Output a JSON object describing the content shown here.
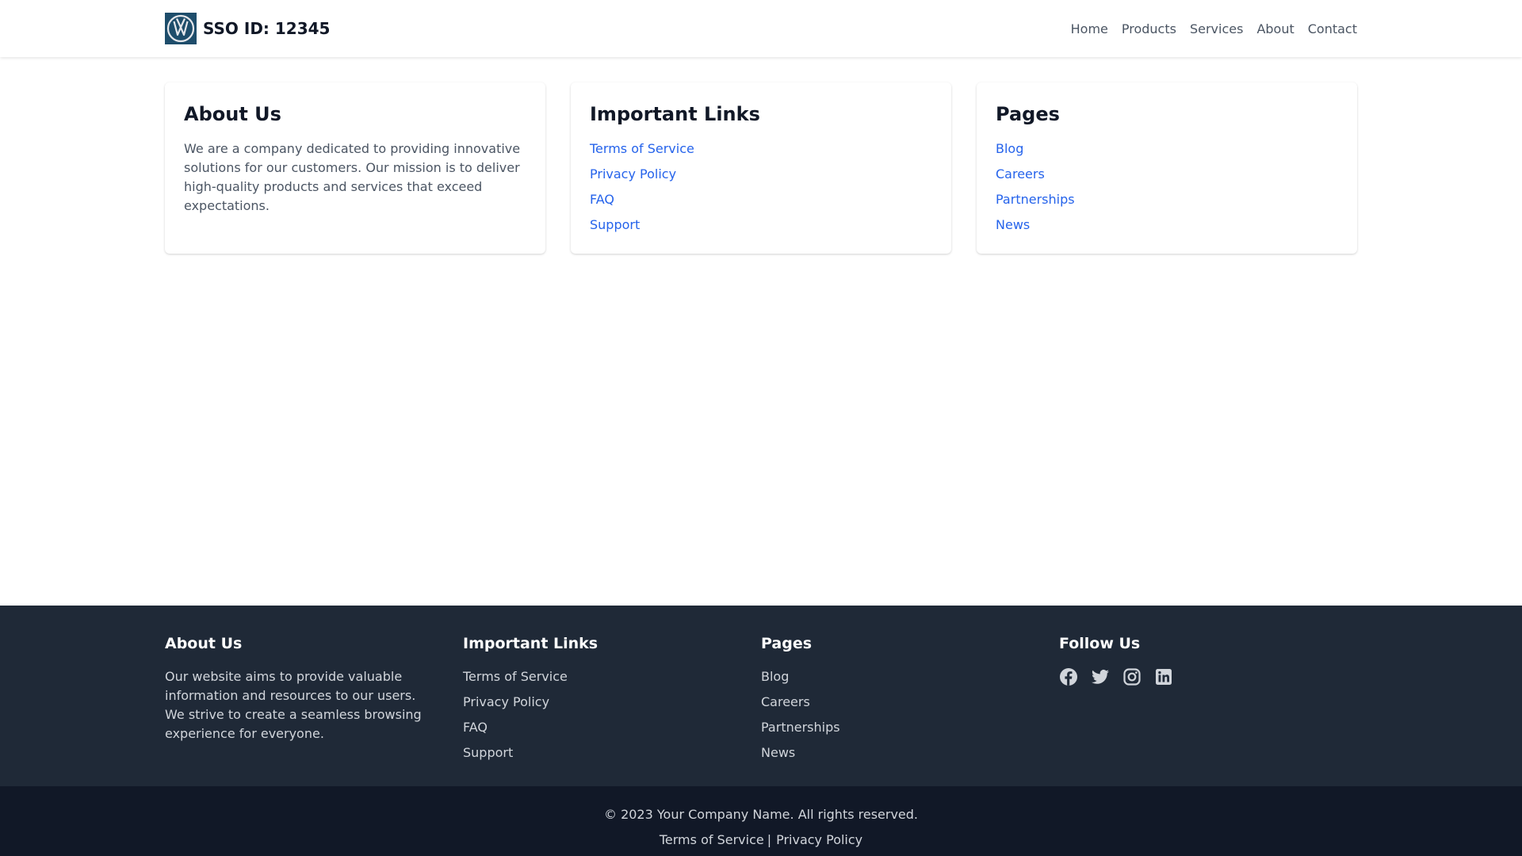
{
  "header": {
    "logo_icon": "vw-logo-icon",
    "title": "SSO ID: 12345",
    "nav": [
      {
        "label": "Home"
      },
      {
        "label": "Products"
      },
      {
        "label": "Services"
      },
      {
        "label": "About"
      },
      {
        "label": "Contact"
      }
    ]
  },
  "cards": {
    "about": {
      "title": "About Us",
      "text": "We are a company dedicated to providing innovative solutions for our customers. Our mission is to deliver high-quality products and services that exceed expectations."
    },
    "links": {
      "title": "Important Links",
      "items": [
        {
          "label": "Terms of Service"
        },
        {
          "label": "Privacy Policy"
        },
        {
          "label": "FAQ"
        },
        {
          "label": "Support"
        }
      ]
    },
    "pages": {
      "title": "Pages",
      "items": [
        {
          "label": "Blog"
        },
        {
          "label": "Careers"
        },
        {
          "label": "Partnerships"
        },
        {
          "label": "News"
        }
      ]
    }
  },
  "footer": {
    "about": {
      "title": "About Us",
      "text": "Our website aims to provide valuable information and resources to our users. We strive to create a seamless browsing experience for everyone."
    },
    "links": {
      "title": "Important Links",
      "items": [
        {
          "label": "Terms of Service"
        },
        {
          "label": "Privacy Policy"
        },
        {
          "label": "FAQ"
        },
        {
          "label": "Support"
        }
      ]
    },
    "pages": {
      "title": "Pages",
      "items": [
        {
          "label": "Blog"
        },
        {
          "label": "Careers"
        },
        {
          "label": "Partnerships"
        },
        {
          "label": "News"
        }
      ]
    },
    "follow": {
      "title": "Follow Us",
      "icons": [
        "facebook-icon",
        "twitter-icon",
        "instagram-icon",
        "linkedin-icon"
      ]
    }
  },
  "bottom": {
    "copyright": "© 2023 Your Company Name. All rights reserved.",
    "terms_label": "Terms of Service",
    "separator": "|",
    "privacy_label": "Privacy Policy"
  },
  "colors": {
    "link_blue": "#2563eb",
    "footer_bg": "#1f2937",
    "bottom_bg": "#111827",
    "logo_bg": "#1e4d6b"
  }
}
